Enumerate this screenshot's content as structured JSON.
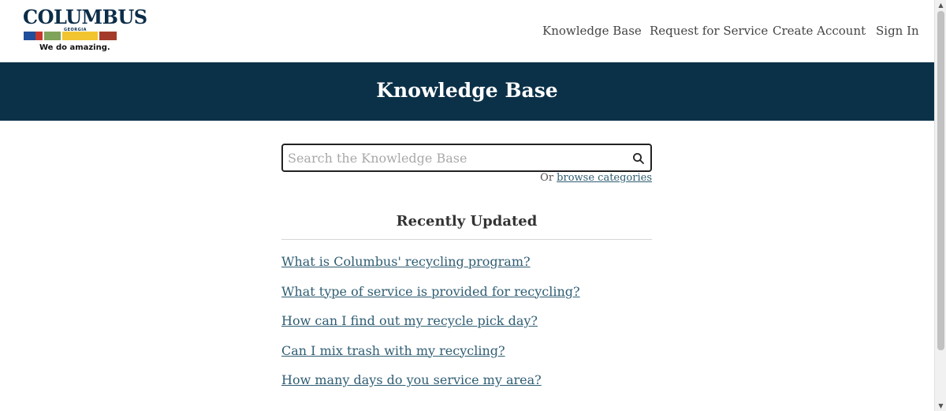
{
  "brand": {
    "logo_word": "COLUMBUS",
    "logo_state": "GEORGIA",
    "tagline": "We do amazing.",
    "bar_colors": [
      "#1f4e9c",
      "#c8372d",
      "#7fa35a",
      "#f2c530",
      "#a43b2a"
    ],
    "primary_color": "#0b3148",
    "link_color": "#2f5d73"
  },
  "nav": {
    "items": [
      {
        "label": "Knowledge Base",
        "active": true
      },
      {
        "label": "Request for Service",
        "active": false
      },
      {
        "label": "Create Account",
        "active": false
      },
      {
        "label": "Sign In",
        "active": false
      }
    ]
  },
  "banner": {
    "title": "Knowledge Base"
  },
  "search": {
    "placeholder": "Search the Knowledge Base",
    "value": "",
    "icon": "search-icon"
  },
  "browse": {
    "prefix": "Or",
    "link_label": "browse categories"
  },
  "recent": {
    "title": "Recently Updated",
    "articles": [
      "What is Columbus' recycling program?",
      "What type of service is provided for recycling?",
      "How can I find out my recycle pick day?",
      "Can I mix trash with my recycling?",
      "How many days do you service my area?"
    ]
  }
}
